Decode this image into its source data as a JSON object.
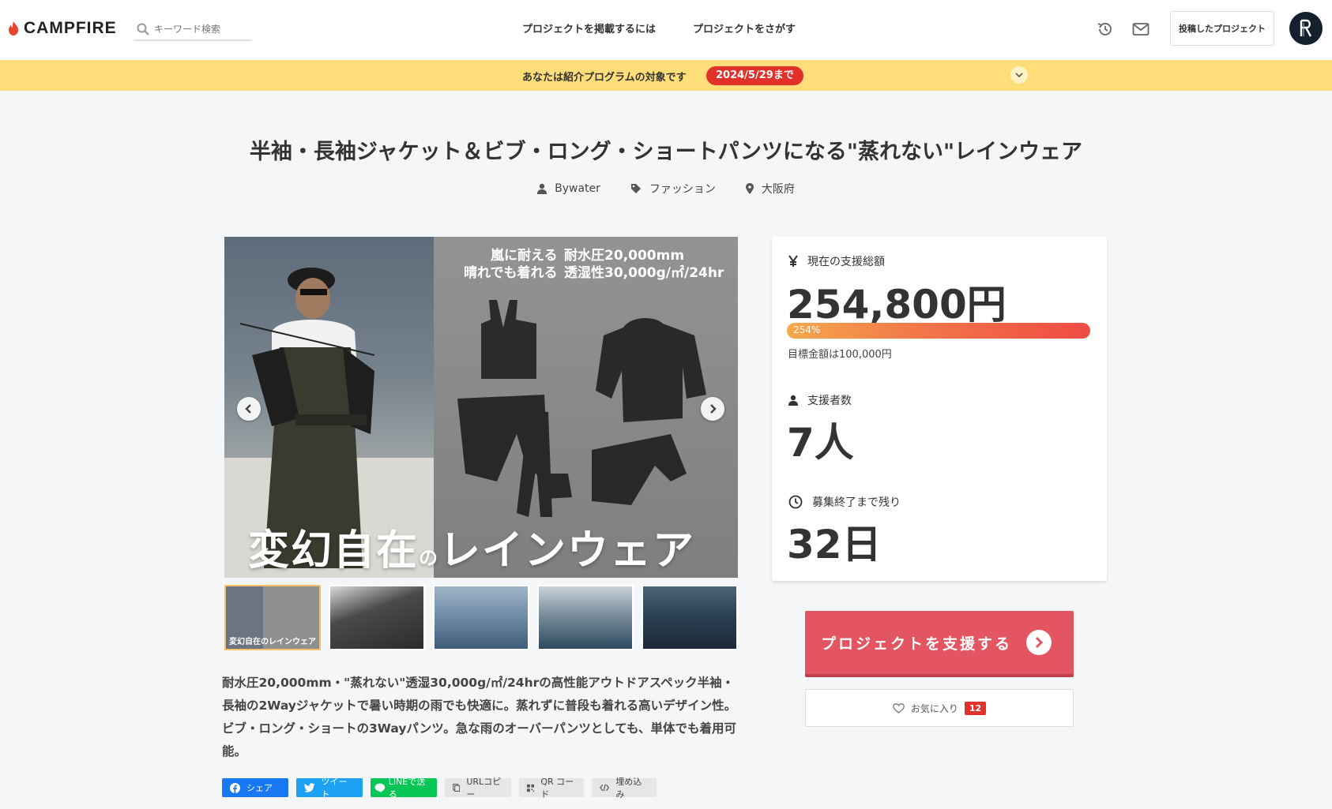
{
  "header": {
    "logo_text": "CAMPFIRE",
    "search_placeholder": "キーワード検索",
    "nav": [
      "プロジェクトを掲載するには",
      "プロジェクトをさがす"
    ],
    "posted_projects_label": "投稿したプロジェクト"
  },
  "banner": {
    "text": "あなたは紹介プログラムの対象です",
    "deadline": "2024/5/29まで"
  },
  "project": {
    "title": "半袖・長袖ジャケット＆ビブ・ロング・ショートパンツになる\"蒸れない\"レインウェア",
    "owner": "Bywater",
    "category": "ファッション",
    "location": "大阪府",
    "hero": {
      "caption_left": "嵐に耐える\n晴れでも着れる",
      "caption_right": "耐水圧20,000mm\n透湿性30,000g/㎡/24hr",
      "big_text": "変幻自在",
      "big_no": "の",
      "big_tail": "レインウェア"
    },
    "thumbnails": [
      {
        "label": "変幻自在のレインウェア",
        "active": true
      },
      {
        "label": "",
        "active": false
      },
      {
        "label": "",
        "active": false
      },
      {
        "label": "",
        "active": false
      },
      {
        "label": "",
        "active": false
      }
    ],
    "description": "耐水圧20,000mm・\"蒸れない\"透湿30,000g/㎡/24hrの高性能アウトドアスペック半袖・長袖の2Wayジャケットで暑い時期の雨でも快適に。蒸れずに普段も着れる高いデザイン性。ビブ・ロング・ショートの3Wayパンツ。急な雨のオーバーパンツとしても、単体でも着用可能。"
  },
  "share": {
    "facebook": "シェア",
    "twitter": "ツイート",
    "line": "LINEで送る",
    "url_copy": "URLコピー",
    "qr": "QR コード",
    "embed": "埋め込み"
  },
  "stats": {
    "raised_label": "現在の支援総額",
    "raised_value": "254,800円",
    "percent": 254,
    "percent_label": "254%",
    "goal": "目標金額は100,000円",
    "backers_label": "支援者数",
    "backers_value": "7人",
    "remaining_label": "募集終了まで残り",
    "remaining_value": "32日"
  },
  "actions": {
    "support_label": "プロジェクトを支援する",
    "favorite_label": "お気に入り",
    "favorite_count": "12"
  },
  "colors": {
    "accent": "#e35560",
    "banner": "#ffde7a",
    "badge": "#e2302b"
  }
}
